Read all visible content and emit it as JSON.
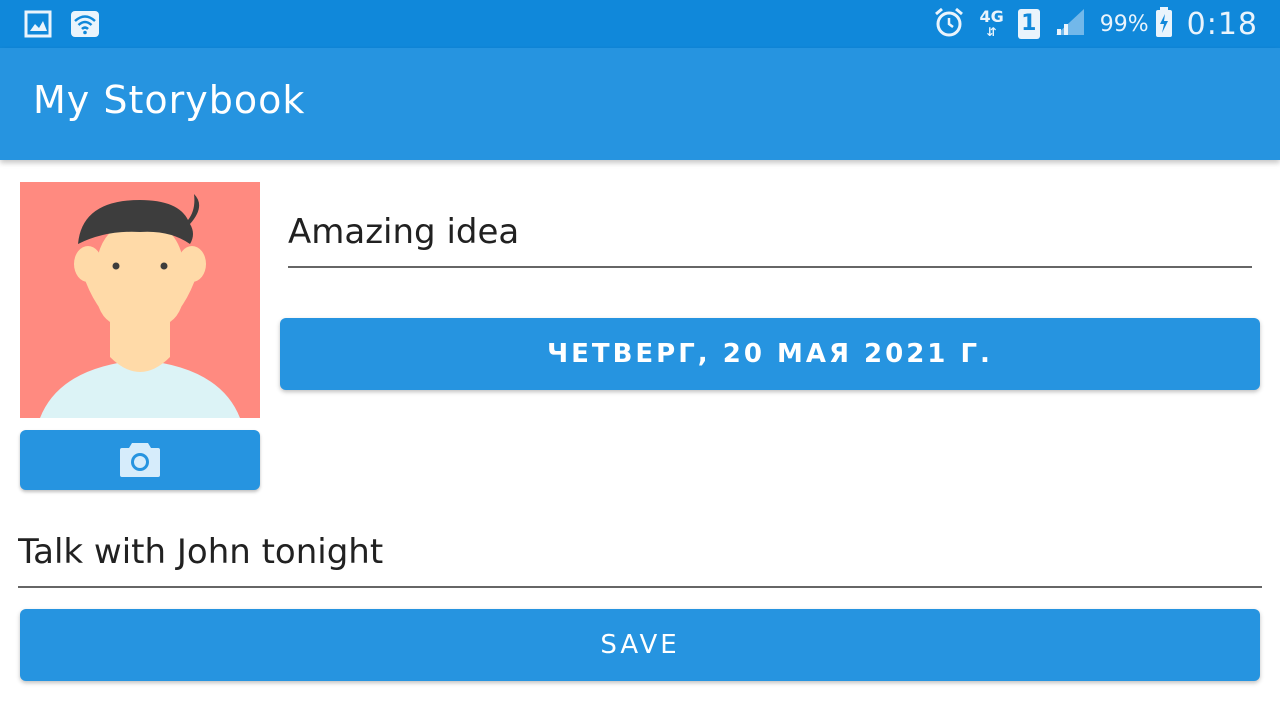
{
  "status_bar": {
    "left_icons": [
      "gallery-icon",
      "wifi-icon"
    ],
    "alarm_icon": "alarm-icon",
    "network_type": "4G",
    "sim_slot": "1",
    "signal_icon": "signal-icon",
    "battery_percent": "99%",
    "battery_icon": "battery-charging-icon",
    "time": "0:18"
  },
  "app_bar": {
    "title": "My Storybook"
  },
  "form": {
    "title_value": "Amazing idea",
    "date_label": "ЧЕТВЕРГ, 20 МАЯ 2021 Г.",
    "camera_icon": "camera-icon",
    "description_value": "Talk with John tonight",
    "save_label": "SAVE"
  },
  "colors": {
    "status_bar": "#1088DA",
    "primary": "#2694E0",
    "avatar_background": "#FF8A80"
  }
}
